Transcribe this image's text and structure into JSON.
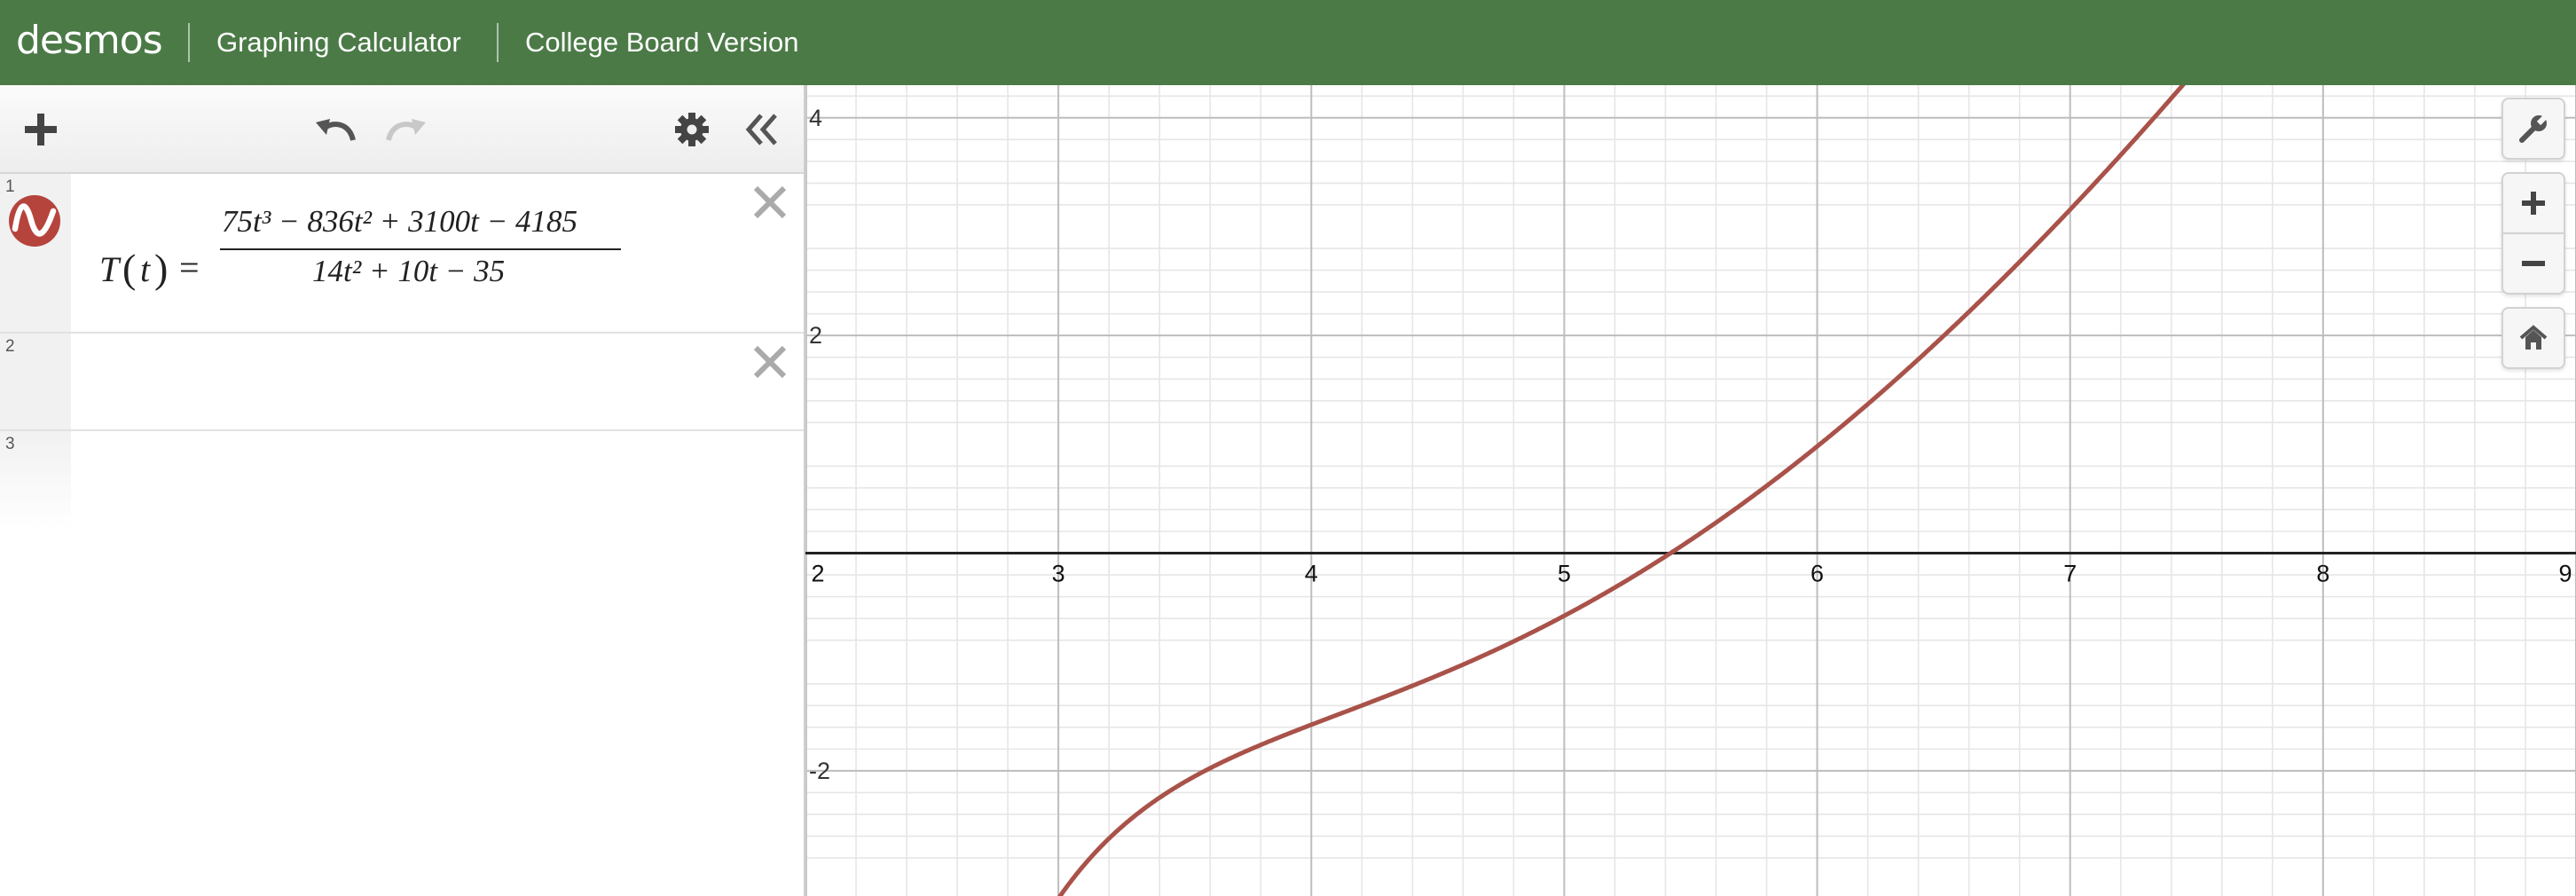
{
  "header": {
    "logo": "desmos",
    "title": "Graphing Calculator",
    "version": "College Board Version"
  },
  "expressions": [
    {
      "index": "1",
      "lhs_fn": "T",
      "lhs_var": "t",
      "numerator": "75t³ − 836t² + 3100t − 4185",
      "denominator": "14t² + 10t − 35",
      "color": "#c0504d"
    },
    {
      "index": "2"
    },
    {
      "index": "3"
    }
  ],
  "graph": {
    "x_ticks": [
      "2",
      "3",
      "4",
      "5",
      "6",
      "7",
      "8",
      "9"
    ],
    "y_ticks": [
      "4",
      "2",
      "-2"
    ],
    "x_range": [
      2,
      9
    ],
    "y_range": [
      -3.15,
      4.3
    ],
    "curve_color": "#a9524a"
  }
}
